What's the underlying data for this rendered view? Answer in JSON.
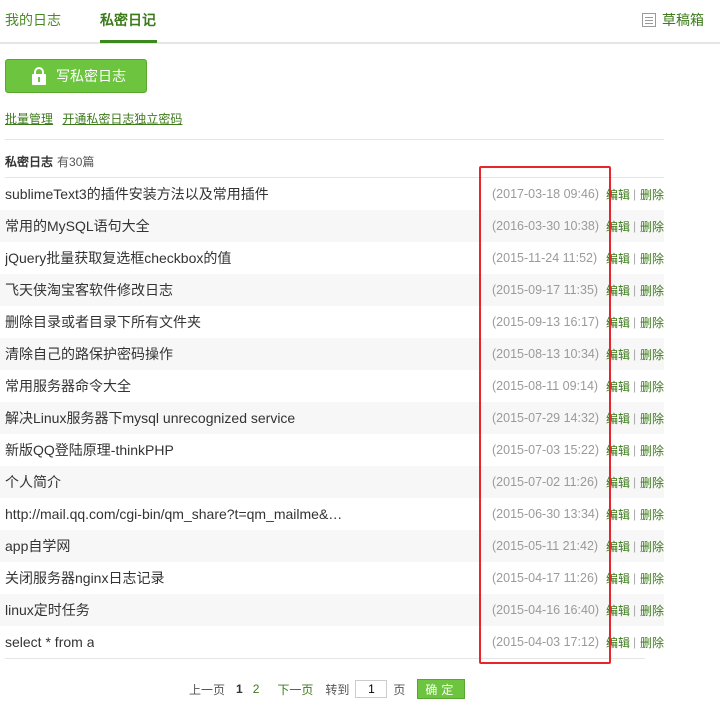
{
  "tabs": {
    "my_diary": "我的日志",
    "private_diary": "私密日记",
    "drafts": "草稿箱"
  },
  "actions": {
    "write_private": "写私密日志",
    "batch_manage": "批量管理",
    "open_password": "开通私密日志独立密码"
  },
  "list": {
    "title": "私密日志",
    "count": "有30篇",
    "edit_label": "编辑",
    "separator": "|",
    "delete_label": "删除",
    "items": [
      {
        "title": "sublimeText3的插件安装方法以及常用插件",
        "date": "(2017-03-18 09:46)"
      },
      {
        "title": "常用的MySQL语句大全",
        "date": "(2016-03-30 10:38)"
      },
      {
        "title": "jQuery批量获取复选框checkbox的值",
        "date": "(2015-11-24 11:52)"
      },
      {
        "title": "飞天侠淘宝客软件修改日志",
        "date": "(2015-09-17 11:35)"
      },
      {
        "title": "删除目录或者目录下所有文件夹",
        "date": "(2015-09-13 16:17)"
      },
      {
        "title": "清除自己的路保护密码操作",
        "date": "(2015-08-13 10:34)"
      },
      {
        "title": "常用服务器命令大全",
        "date": "(2015-08-11 09:14)"
      },
      {
        "title": "解决Linux服务器下mysql unrecognized service",
        "date": "(2015-07-29 14:32)"
      },
      {
        "title": "新版QQ登陆原理-thinkPHP",
        "date": "(2015-07-03 15:22)"
      },
      {
        "title": "个人简介",
        "date": "(2015-07-02 11:26)"
      },
      {
        "title": "http://mail.qq.com/cgi-bin/qm_share?t=qm_mailme&…",
        "date": "(2015-06-30 13:34)"
      },
      {
        "title": "app自学网",
        "date": "(2015-05-11 21:42)"
      },
      {
        "title": "关闭服务器nginx日志记录",
        "date": "(2015-04-17 11:26)"
      },
      {
        "title": "linux定时任务",
        "date": "(2015-04-16 16:40)"
      },
      {
        "title": "select * from a",
        "date": "(2015-04-03 17:12)"
      }
    ]
  },
  "pager": {
    "prev": "上一页",
    "current": "1",
    "page2": "2",
    "next": "下一页",
    "goto": "转到",
    "input_value": "1",
    "page_unit": "页",
    "confirm": "确定"
  },
  "colors": {
    "accent_green": "#6cc43f",
    "link_green": "#3c7a1a",
    "highlight_red": "#e8252a"
  }
}
